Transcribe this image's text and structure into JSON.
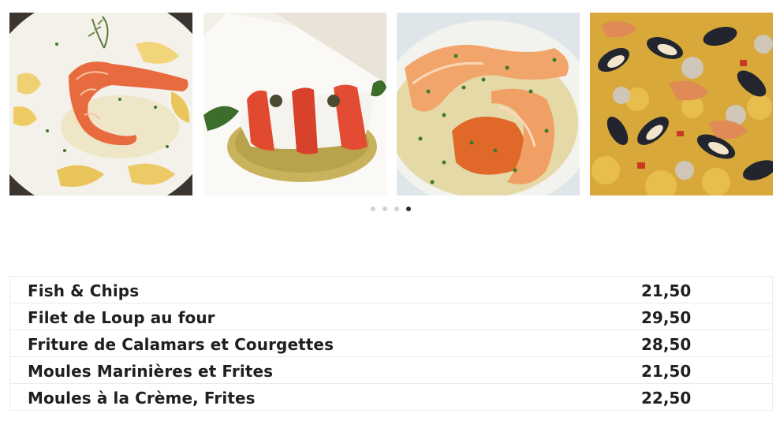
{
  "gallery": {
    "photos": [
      {
        "icon": "food-photo-prawns-puree"
      },
      {
        "icon": "food-photo-fish-risotto"
      },
      {
        "icon": "food-photo-prawns-sauce"
      },
      {
        "icon": "food-photo-paella-mussels"
      }
    ],
    "pager": {
      "count": 4,
      "active_index": 3
    }
  },
  "menu": {
    "items": [
      {
        "name": "Fish & Chips",
        "price": "21,50"
      },
      {
        "name": "Filet de Loup au four",
        "price": "29,50"
      },
      {
        "name": "Friture de Calamars et Courgettes",
        "price": "28,50"
      },
      {
        "name": "Moules Marinières et Frites",
        "price": "21,50"
      },
      {
        "name": "Moules à la Crème, Frites",
        "price": "22,50"
      }
    ]
  },
  "colors": {
    "text": "#1f1f1f",
    "dot_inactive": "#d2d2d2",
    "dot_active": "#2e2e2e",
    "border": "#ececec"
  }
}
